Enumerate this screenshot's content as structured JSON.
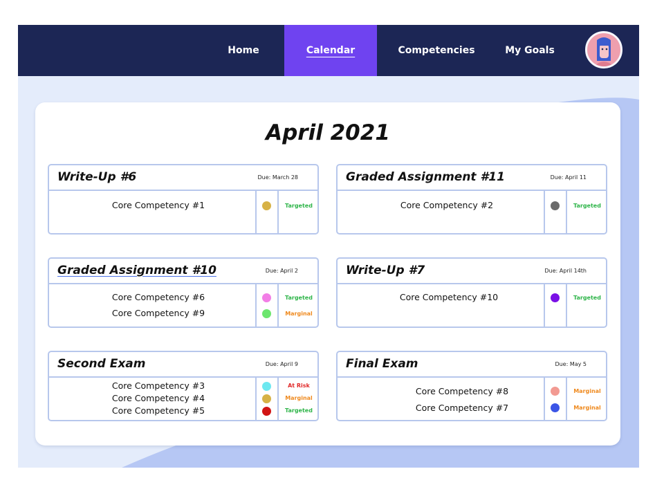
{
  "nav": {
    "items": [
      {
        "label": "Home",
        "active": false
      },
      {
        "label": "Calendar",
        "active": true
      },
      {
        "label": "Competencies",
        "active": false
      },
      {
        "label": "My Goals",
        "active": false
      }
    ],
    "colors": {
      "bar": "#1c2655",
      "active": "#6f43f0"
    }
  },
  "calendar": {
    "month_title": "April 2021"
  },
  "status_colors": {
    "Targeted": "#2fb54a",
    "Marginal": "#ef8a1f",
    "At Risk": "#e12a2a"
  },
  "cards": [
    {
      "title": "Write-Up #6",
      "due": "Due: March 28",
      "underlined": false,
      "competencies": [
        {
          "name": "Core Competency #1",
          "dot": "#d7b246",
          "status": "Targeted"
        }
      ]
    },
    {
      "title": "Graded Assignment #11",
      "due": "Due: April 11",
      "underlined": false,
      "competencies": [
        {
          "name": "Core Competency #2",
          "dot": "#6b6b6b",
          "status": "Targeted"
        }
      ]
    },
    {
      "title": "Graded Assignment #10",
      "due": "Due: April 2",
      "underlined": true,
      "competencies": [
        {
          "name": "Core Competency #6",
          "dot": "#f27ee6",
          "status": "Targeted"
        },
        {
          "name": "Core Competency #9",
          "dot": "#6ce66e",
          "status": "Marginal"
        }
      ]
    },
    {
      "title": "Write-Up #7",
      "due": "Due: April 14th",
      "underlined": false,
      "competencies": [
        {
          "name": "Core Competency #10",
          "dot": "#7a10e6",
          "status": "Targeted"
        }
      ]
    },
    {
      "title": "Second Exam",
      "due": "Due: April 9",
      "underlined": false,
      "competencies": [
        {
          "name": "Core Competency #3",
          "dot": "#6de8f0",
          "status": "At Risk"
        },
        {
          "name": "Core Competency #4",
          "dot": "#d7b246",
          "status": "Marginal"
        },
        {
          "name": "Core Competency #5",
          "dot": "#d11414",
          "status": "Targeted"
        }
      ]
    },
    {
      "title": "Final Exam",
      "due": "Due: May 5",
      "underlined": false,
      "competencies": [
        {
          "name": "Core Competency #8",
          "dot": "#f29a92",
          "status": "Marginal"
        },
        {
          "name": "Core Competency #7",
          "dot": "#3b55e6",
          "status": "Marginal"
        }
      ]
    }
  ]
}
